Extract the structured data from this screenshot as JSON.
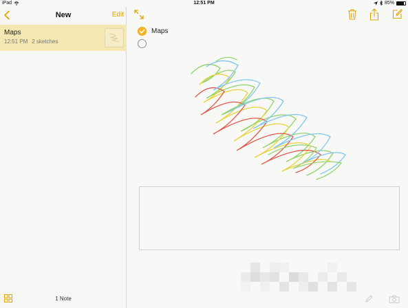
{
  "status_bar": {
    "device": "iPad",
    "time": "12:51 PM",
    "battery": "85%",
    "battery_level": 0.85
  },
  "sidebar": {
    "title": "New",
    "edit_label": "Edit",
    "notes": [
      {
        "title": "Maps",
        "time": "12:51 PM",
        "detail": "2 sketches"
      }
    ],
    "count_label": "1 Note"
  },
  "editor": {
    "checklist": [
      {
        "label": "Maps",
        "checked": true
      },
      {
        "label": "",
        "checked": false
      }
    ]
  },
  "colors": {
    "accent": "#e0a400",
    "selected_row": "#f4e7b2",
    "check": "#f4b42a",
    "sketch_red": "#e0584a",
    "sketch_yellow": "#e8d23a",
    "sketch_green": "#8fd36a",
    "sketch_blue": "#7fc8ec"
  }
}
